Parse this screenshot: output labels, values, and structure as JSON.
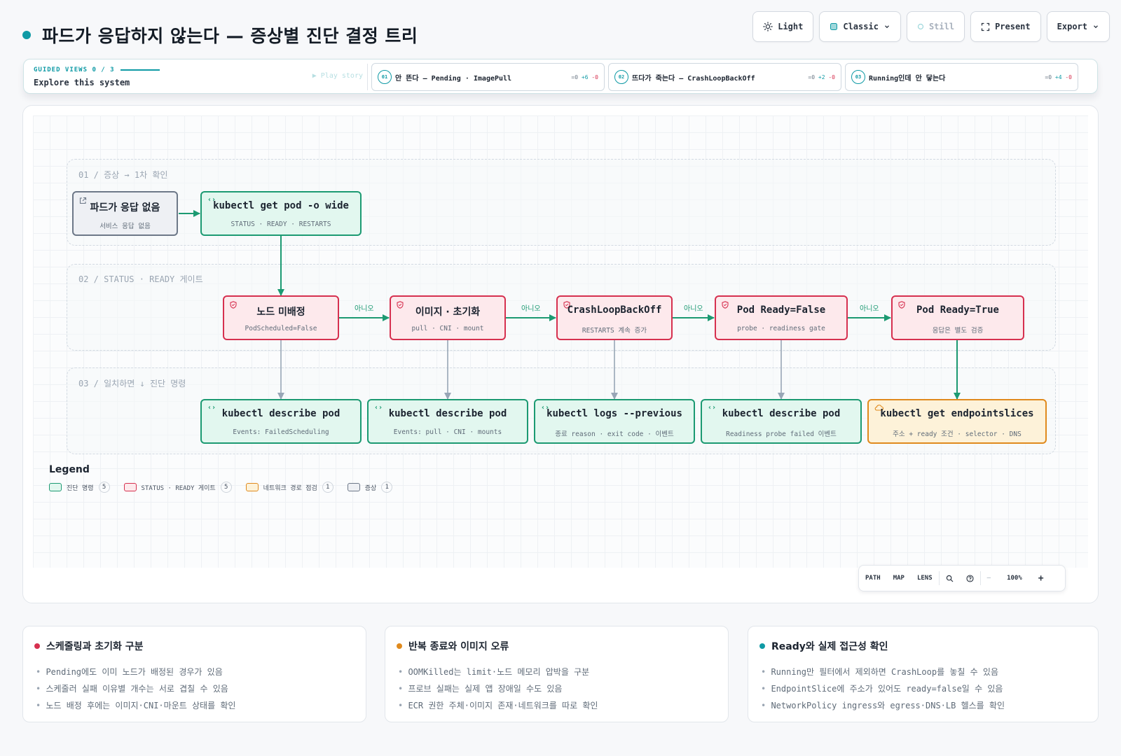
{
  "title": "파드가 응답하지 않는다 — 증상별 진단 결정 트리",
  "toolbar": {
    "light": "Light",
    "classic": "Classic",
    "still": "Still",
    "present": "Present",
    "export": "Export"
  },
  "guided": {
    "kicker": "GUIDED VIEWS 0 / 3",
    "explore": "Explore this system",
    "play": "▶ Play story",
    "stories": [
      {
        "num": "01",
        "label": "안 뜬다 — Pending · ImagePull",
        "eq": "=0",
        "plus": "+6",
        "minus": "-0"
      },
      {
        "num": "02",
        "label": "뜨다가 죽는다 — CrashLoopBackOff",
        "eq": "=0",
        "plus": "+2",
        "minus": "-0"
      },
      {
        "num": "03",
        "label": "Running인데 안 닿는다",
        "eq": "=0",
        "plus": "+4",
        "minus": "-0"
      }
    ]
  },
  "lanes": [
    {
      "label": "01 / 증상 → 1차 확인"
    },
    {
      "label": "02 / STATUS · READY 게이트"
    },
    {
      "label": "03 / 일치하면 ↓ 진단 명령"
    }
  ],
  "nodes": {
    "symptom": {
      "title": "파드가 응답 없음",
      "sub": "서비스 응답 없음"
    },
    "getpod": {
      "title": "kubectl get pod -o wide",
      "sub": "STATUS · READY · RESTARTS"
    },
    "unscheduled": {
      "title": "노드 미배정",
      "sub": "PodScheduled=False"
    },
    "image_init": {
      "title": "이미지 · 초기화",
      "sub": "pull · CNI · mount"
    },
    "crashloop": {
      "title": "CrashLoopBackOff",
      "sub": "RESTARTS 계속 증가"
    },
    "ready_false": {
      "title": "Pod Ready=False",
      "sub": "probe · readiness gate"
    },
    "ready_true": {
      "title": "Pod Ready=True",
      "sub": "응답은 별도 검증"
    },
    "desc_sched": {
      "title": "kubectl describe pod",
      "sub": "Events: FailedScheduling"
    },
    "desc_pull": {
      "title": "kubectl describe pod",
      "sub": "Events: pull · CNI · mounts"
    },
    "logs_prev": {
      "title": "kubectl logs --previous",
      "sub": "종료 reason · exit code · 이벤트"
    },
    "desc_probe": {
      "title": "kubectl describe pod",
      "sub": "Readiness probe failed 이벤트"
    },
    "endpointslices": {
      "title": "kubectl get endpointslices",
      "sub": "주소 + ready 조건 · selector · DNS"
    }
  },
  "edge_labels": [
    "아니오",
    "아니오",
    "아니오",
    "아니오"
  ],
  "legend": {
    "title": "Legend",
    "items": [
      {
        "label": "진단 명령",
        "count": "5",
        "color": "#1c9a72"
      },
      {
        "label": "STATUS · READY 게이트",
        "count": "5",
        "color": "#d6304f"
      },
      {
        "label": "네트워크 경로 점검",
        "count": "1",
        "color": "#e08a1d"
      },
      {
        "label": "증상",
        "count": "1",
        "color": "#6d7888"
      }
    ]
  },
  "view_controls": {
    "path": "PATH",
    "map": "MAP",
    "lens": "LENS",
    "minus": "—",
    "zoom": "100%",
    "plus": "+"
  },
  "cards": [
    {
      "title": "스케줄링과 초기화 구분",
      "color": "#d6304f",
      "items": [
        "Pending에도 이미 노드가 배정된 경우가 있음",
        "스케줄러 실패 이유별 개수는 서로 겹칠 수 있음",
        "노드 배정 후에는 이미지·CNI·마운트 상태를 확인"
      ]
    },
    {
      "title": "반복 종료와 이미지 오류",
      "color": "#e08a1d",
      "items": [
        "OOMKilled는 limit·노드 메모리 압박을 구분",
        "프로브 실패는 실제 앱 장애일 수도 있음",
        "ECR 권한 주체·이미지 존재·네트워크를 따로 확인"
      ]
    },
    {
      "title": "Ready와 실제 접근성 확인",
      "color": "#0f9aa5",
      "items": [
        "Running만 필터에서 제외하면 CrashLoop를 놓칠 수 있음",
        "EndpointSlice에 주소가 있어도 ready=false일 수 있음",
        "NetworkPolicy ingress와 egress·DNS·LB 헬스를 확인"
      ]
    }
  ]
}
